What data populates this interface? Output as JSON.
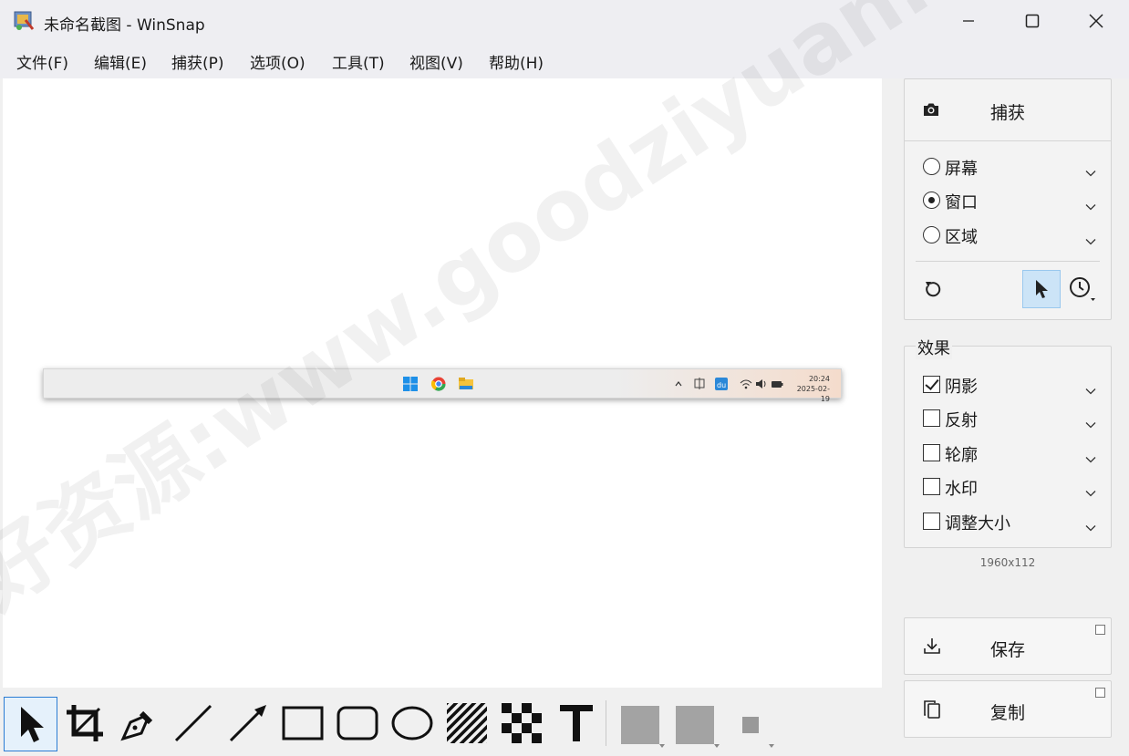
{
  "window": {
    "title": "未命名截图 - WinSnap"
  },
  "menu": [
    {
      "label": "文件(F)"
    },
    {
      "label": "编辑(E)"
    },
    {
      "label": "捕获(P)"
    },
    {
      "label": "选项(O)"
    },
    {
      "label": "工具(T)"
    },
    {
      "label": "视图(V)"
    },
    {
      "label": "帮助(H)"
    }
  ],
  "capture": {
    "label": "捕获",
    "options": [
      {
        "label": "屏幕",
        "selected": false
      },
      {
        "label": "窗口",
        "selected": true
      },
      {
        "label": "区域",
        "selected": false
      }
    ]
  },
  "effects": {
    "title": "效果",
    "items": [
      {
        "label": "阴影",
        "checked": true
      },
      {
        "label": "反射",
        "checked": false
      },
      {
        "label": "轮廓",
        "checked": false
      },
      {
        "label": "水印",
        "checked": false
      },
      {
        "label": "调整大小",
        "checked": false
      }
    ]
  },
  "image_size": "1960x112",
  "actions": {
    "save_label": "保存",
    "copy_label": "复制"
  },
  "preview": {
    "taskbar_time": "20:24",
    "taskbar_date": "2025-02-19"
  },
  "watermark": "好资源:www.goodziyuan.com",
  "colors": {
    "accent": "#2b7cd3",
    "active_bg": "#cce4f7",
    "swatch": "#a3a3a3"
  }
}
